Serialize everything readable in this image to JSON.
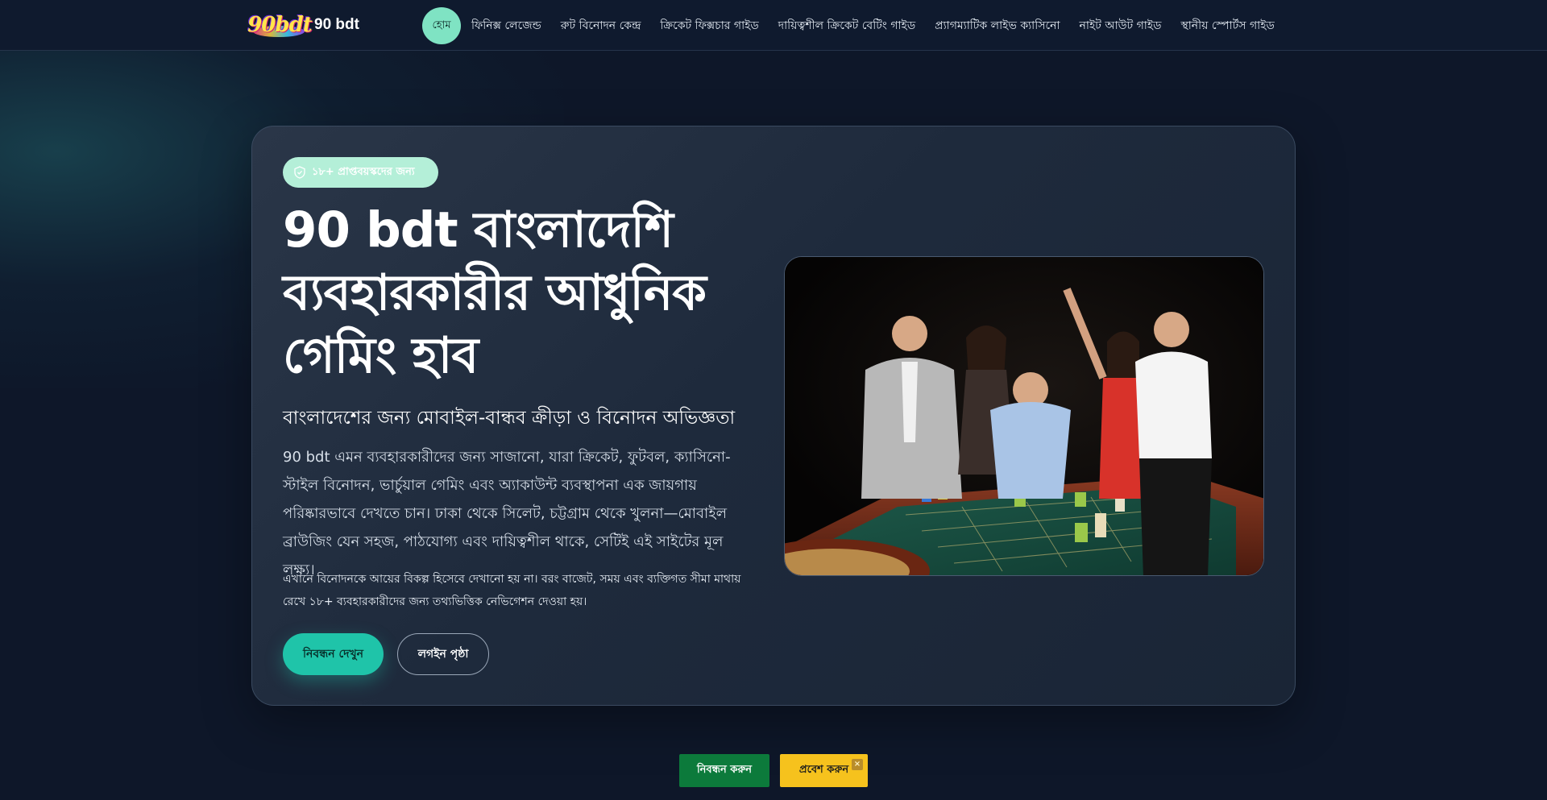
{
  "brand": {
    "logo_text": "90bdt",
    "name": "90 bdt"
  },
  "nav": {
    "items": [
      {
        "label": "হোম",
        "active": true
      },
      {
        "label": "ফিনিক্স লেজেন্ড"
      },
      {
        "label": "রুট বিনোদন কেন্দ্র"
      },
      {
        "label": "ক্রিকেট ফিক্সচার গাইড"
      },
      {
        "label": "দায়িত্বশীল ক্রিকেট বেটিং গাইড"
      },
      {
        "label": "প্র্যাগম্যাটিক লাইভ ক্যাসিনো"
      },
      {
        "label": "নাইট আউট গাইড"
      },
      {
        "label": "স্থানীয় স্পোর্টস গাইড"
      }
    ]
  },
  "hero": {
    "badge": "১৮+ প্রাপ্তবয়স্কদের জন্য",
    "title": "90 bdt বাংলাদেশি ব্যবহারকারীর আধুনিক গেমিং হাব",
    "subtitle": "বাংলাদেশের জন্য মোবাইল-বান্ধব ক্রীড়া ও বিনোদন অভিজ্ঞতা",
    "description": "90 bdt এমন ব্যবহারকারীদের জন্য সাজানো, যারা ক্রিকেট, ফুটবল, ক্যাসিনো-স্টাইল বিনোদন, ভার্চুয়াল গেমিং এবং অ্যাকাউন্ট ব্যবস্থাপনা এক জায়গায় পরিষ্কারভাবে দেখতে চান। ঢাকা থেকে সিলেট, চট্টগ্রাম থেকে খুলনা—মোবাইল ব্রাউজিং যেন সহজ, পাঠযোগ্য এবং দায়িত্বশীল থাকে, সেটিই এই সাইটের মূল লক্ষ্য।",
    "note": "এখানে বিনোদনকে আয়ের বিকল্প হিসেবে দেখানো হয় না। বরং বাজেট, সময় এবং ব্যক্তিগত সীমা মাথায় রেখে ১৮+ ব্যবহারকারীদের জন্য তথ্যভিত্তিক নেভিগেশন দেওয়া হয়।",
    "primary_button": "নিবন্ধন দেখুন",
    "secondary_button": "লগইন পৃষ্ঠা"
  },
  "sticky": {
    "register": "নিবন্ধন করুন",
    "login": "প্রবেশ করুন",
    "close": "×"
  }
}
